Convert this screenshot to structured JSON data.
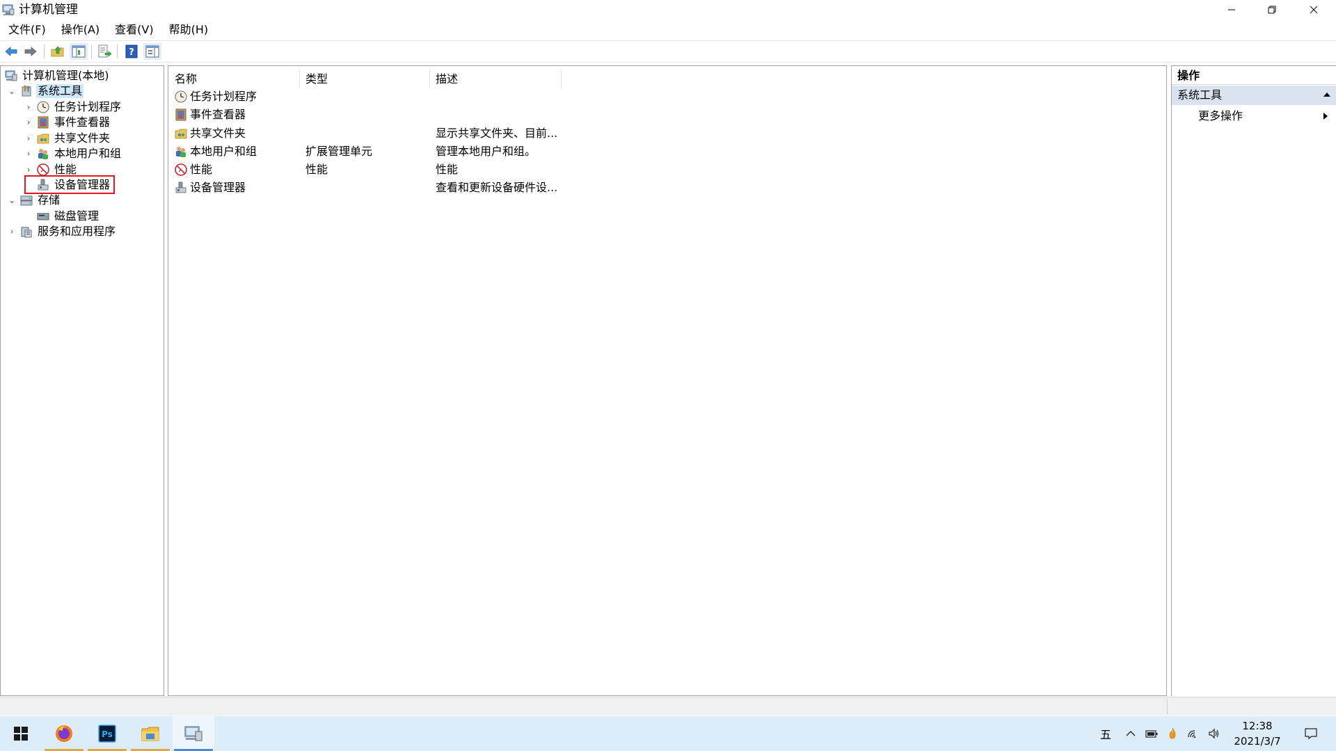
{
  "window": {
    "title": "计算机管理"
  },
  "menu": [
    "文件(F)",
    "操作(A)",
    "查看(V)",
    "帮助(H)"
  ],
  "toolbar": {
    "buttons": [
      "back-icon",
      "forward-icon",
      "up-folder-icon",
      "show-hide-tree-icon",
      "export-list-icon",
      "help-icon",
      "show-hide-action-pane-icon"
    ]
  },
  "tree": {
    "root": "计算机管理(本地)",
    "system_tools": "系统工具",
    "task_scheduler": "任务计划程序",
    "event_viewer": "事件查看器",
    "shared_folders": "共享文件夹",
    "local_users": "本地用户和组",
    "performance": "性能",
    "device_manager": "设备管理器",
    "storage": "存储",
    "disk_management": "磁盘管理",
    "services_apps": "服务和应用程序",
    "selected": "系统工具",
    "highlighted": "设备管理器",
    "highlight_color": "#e0191e"
  },
  "list": {
    "columns": [
      "名称",
      "类型",
      "描述"
    ],
    "rows": [
      {
        "name": "任务计划程序",
        "type": "",
        "desc": "",
        "icon": "task-scheduler-icon"
      },
      {
        "name": "事件查看器",
        "type": "",
        "desc": "",
        "icon": "event-viewer-icon"
      },
      {
        "name": "共享文件夹",
        "type": "",
        "desc": "显示共享文件夹、目前...",
        "icon": "shared-folder-icon"
      },
      {
        "name": "本地用户和组",
        "type": "扩展管理单元",
        "desc": "管理本地用户和组。",
        "icon": "users-icon"
      },
      {
        "name": "性能",
        "type": "性能",
        "desc": "性能",
        "icon": "performance-icon"
      },
      {
        "name": "设备管理器",
        "type": "",
        "desc": "查看和更新设备硬件设...",
        "icon": "device-manager-icon"
      }
    ]
  },
  "actions": {
    "header": "操作",
    "group": "系统工具",
    "more": "更多操作"
  },
  "taskbar": {
    "apps": [
      "start-icon",
      "firefox-icon",
      "photoshop-icon",
      "file-explorer-icon",
      "computer-management-icon"
    ],
    "ime": "五",
    "time": "12:38",
    "date": "2021/3/7"
  },
  "colors": {
    "selection": "#cce8ff",
    "actions_group_bg": "#d9e4f0",
    "taskbar_bg": "#dcecf8",
    "accent": "#4a8bd4"
  }
}
